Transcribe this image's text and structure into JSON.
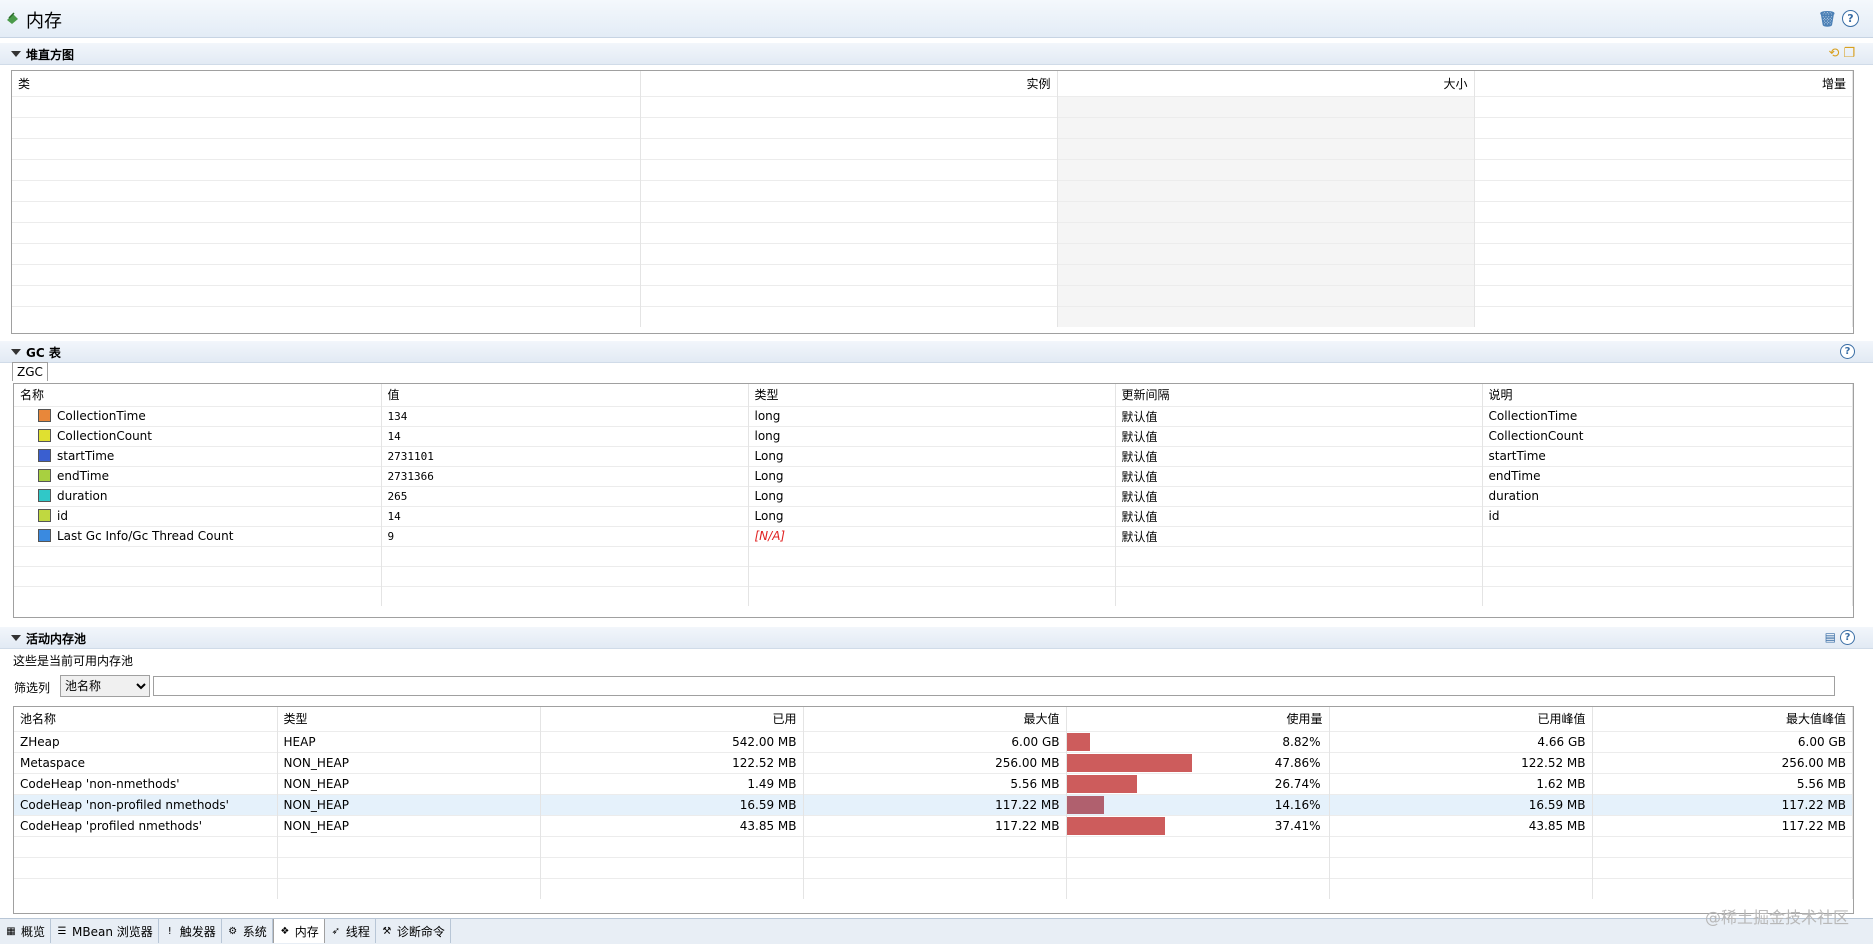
{
  "header": {
    "title": "内存"
  },
  "histogram": {
    "title": "堆直方图",
    "columns": [
      "类",
      "实例",
      "大小",
      "增量"
    ]
  },
  "gc": {
    "title": "GC 表",
    "tab": "ZGC",
    "columns": [
      "名称",
      "值",
      "类型",
      "更新间隔",
      "说明"
    ],
    "rows": [
      {
        "name": "CollectionTime",
        "color": "#e8873a",
        "value": "134",
        "type": "long",
        "interval": "默认值",
        "desc": "CollectionTime"
      },
      {
        "name": "CollectionCount",
        "color": "#e0e030",
        "value": "14",
        "type": "long",
        "interval": "默认值",
        "desc": "CollectionCount"
      },
      {
        "name": "startTime",
        "color": "#3a5fd0",
        "value": "2731101",
        "type": "Long",
        "interval": "默认值",
        "desc": "startTime"
      },
      {
        "name": "endTime",
        "color": "#a8d040",
        "value": "2731366",
        "type": "Long",
        "interval": "默认值",
        "desc": "endTime"
      },
      {
        "name": "duration",
        "color": "#30c8c8",
        "value": "265",
        "type": "Long",
        "interval": "默认值",
        "desc": "duration"
      },
      {
        "name": "id",
        "color": "#c0d840",
        "value": "14",
        "type": "Long",
        "interval": "默认值",
        "desc": "id"
      },
      {
        "name": "Last Gc Info/Gc Thread Count",
        "color": "#3a8ae0",
        "value": "9",
        "type": "[N/A]",
        "interval": "默认值",
        "desc": ""
      }
    ]
  },
  "pools": {
    "title": "活动内存池",
    "description": "这些是当前可用内存池",
    "filter_label": "筛选列",
    "filter_selected": "池名称",
    "columns": [
      "池名称",
      "类型",
      "已用",
      "最大值",
      "使用量",
      "已用峰值",
      "最大值峰值"
    ],
    "rows": [
      {
        "name": "ZHeap",
        "type": "HEAP",
        "used": "542.00 MB",
        "max": "6.00 GB",
        "usage": "8.82%",
        "usage_pct": 8.82,
        "peak": "4.66 GB",
        "max_peak": "6.00 GB"
      },
      {
        "name": "Metaspace",
        "type": "NON_HEAP",
        "used": "122.52 MB",
        "max": "256.00 MB",
        "usage": "47.86%",
        "usage_pct": 47.86,
        "peak": "122.52 MB",
        "max_peak": "256.00 MB"
      },
      {
        "name": "CodeHeap 'non-nmethods'",
        "type": "NON_HEAP",
        "used": "1.49 MB",
        "max": "5.56 MB",
        "usage": "26.74%",
        "usage_pct": 26.74,
        "peak": "1.62 MB",
        "max_peak": "5.56 MB"
      },
      {
        "name": "CodeHeap 'non-profiled nmethods'",
        "type": "NON_HEAP",
        "used": "16.59 MB",
        "max": "117.22 MB",
        "usage": "14.16%",
        "usage_pct": 14.16,
        "peak": "16.59 MB",
        "max_peak": "117.22 MB"
      },
      {
        "name": "CodeHeap 'profiled nmethods'",
        "type": "NON_HEAP",
        "used": "43.85 MB",
        "max": "117.22 MB",
        "usage": "37.41%",
        "usage_pct": 37.41,
        "peak": "43.85 MB",
        "max_peak": "117.22 MB"
      }
    ],
    "selected_row": 3
  },
  "bottom_tabs": [
    {
      "label": "概览",
      "icon": "overview-icon",
      "glyph": "▦"
    },
    {
      "label": "MBean 浏览器",
      "icon": "mbean-browser-icon",
      "glyph": "☰"
    },
    {
      "label": "触发器",
      "icon": "trigger-icon",
      "glyph": "!"
    },
    {
      "label": "系统",
      "icon": "system-icon",
      "glyph": "⚙"
    },
    {
      "label": "内存",
      "icon": "memory-icon",
      "glyph": "❖"
    },
    {
      "label": "线程",
      "icon": "thread-icon",
      "glyph": "➶"
    },
    {
      "label": "诊断命令",
      "icon": "diagnostic-icon",
      "glyph": "⚒"
    }
  ],
  "active_tab": 4,
  "watermark": "@稀土掘金技术社区"
}
